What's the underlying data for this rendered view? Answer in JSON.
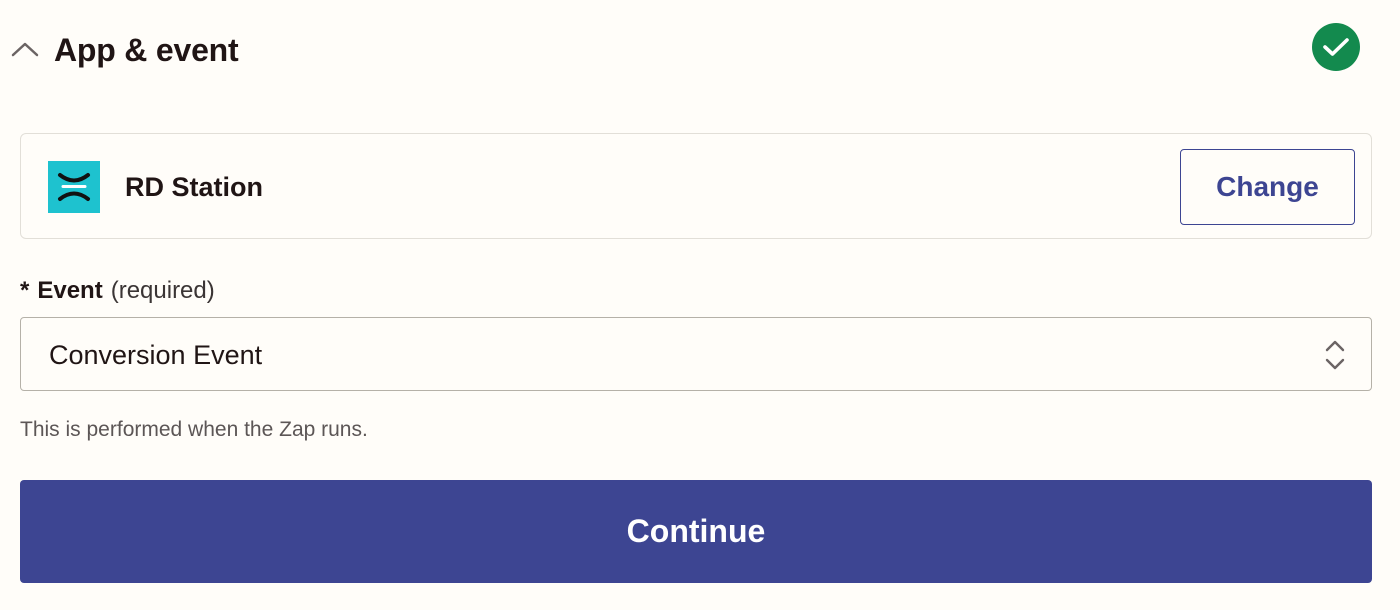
{
  "section": {
    "title": "App & event",
    "collapse_icon": "chevron-up-icon",
    "status_icon": "check-circle-icon",
    "status_color": "#138a4e"
  },
  "app": {
    "name": "RD Station",
    "logo_icon": "rd-station-logo",
    "logo_color": "#1ec2cf",
    "change_label": "Change"
  },
  "event": {
    "required_marker": "*",
    "label": "Event",
    "hint": "(required)",
    "value": "Conversion Event",
    "select_icon": "chevron-up-down-icon"
  },
  "help_text": "This is performed when the Zap runs.",
  "continue_label": "Continue",
  "colors": {
    "accent": "#3d4592",
    "background": "#fffdf9",
    "text": "#201515"
  }
}
